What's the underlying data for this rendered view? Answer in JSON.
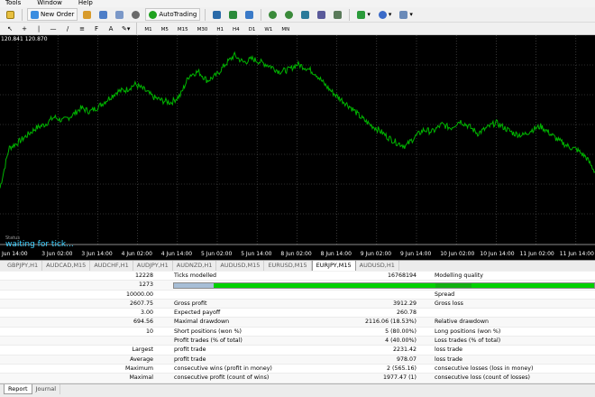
{
  "menu": [
    "Tools",
    "Window",
    "Help"
  ],
  "toolbar": {
    "new_order": "New Order",
    "autotrading": "AutoTrading"
  },
  "timeframes": [
    "M1",
    "M5",
    "M15",
    "M30",
    "H1",
    "H4",
    "D1",
    "W1",
    "MN"
  ],
  "chart": {
    "price_label": "120.841 120.870",
    "status_label": "Status",
    "waiting_text": "waiting for tick...",
    "colors": {
      "background": "#000000",
      "line": "#00b400",
      "grid": "#5a5a5a",
      "axis_text": "#ffffff"
    }
  },
  "chart_data": {
    "type": "line",
    "x_labels": [
      "Jun 14:00",
      "3 Jun 02:00",
      "3 Jun 14:00",
      "4 Jun 02:00",
      "4 Jun 14:00",
      "5 Jun 02:00",
      "5 Jun 14:00",
      "8 Jun 02:00",
      "8 Jun 14:00",
      "9 Jun 02:00",
      "9 Jun 14:00",
      "10 Jun 02:00",
      "10 Jun 14:00",
      "11 Jun 02:00",
      "11 Jun 14:00"
    ],
    "values": [
      62,
      106,
      112,
      120,
      128,
      132,
      140,
      136,
      142,
      150,
      146,
      152,
      160,
      168,
      170,
      176,
      170,
      162,
      158,
      156,
      164,
      186,
      190,
      180,
      186,
      198,
      208,
      200,
      204,
      200,
      196,
      190,
      192,
      198,
      194,
      188,
      176,
      166,
      158,
      150,
      140,
      132,
      126,
      118,
      112,
      108,
      118,
      126,
      124,
      132,
      128,
      136,
      130,
      122,
      128,
      134,
      128,
      122,
      120,
      126,
      130,
      122,
      114,
      108,
      104,
      96,
      80
    ],
    "ylim": [
      0,
      230
    ],
    "grid": true
  },
  "chart_tabs": [
    "GBPJPY,H1",
    "AUDCAD,M15",
    "AUDCHF,H1",
    "AUDJPY,H1",
    "AUDNZD,H1",
    "AUDUSD,M15",
    "EURUSD,M15",
    "EURJPY,M15",
    "AUDUSD,H1"
  ],
  "active_tab": "EURJPY,M15",
  "report": {
    "rows": [
      {
        "v1": "12228",
        "l2": "Ticks modelled",
        "v3": "16768194",
        "l4": "Modelling quality",
        "v5": ""
      },
      {
        "v1": "1273",
        "l2": "",
        "v3": "",
        "l4": "",
        "v5": ""
      },
      {
        "v1": "10000.00",
        "l2": "",
        "v3": "",
        "l4": "Spread",
        "v5": ""
      },
      {
        "v1": "2607.75",
        "l2": "Gross profit",
        "v3": "3912.29",
        "l4": "Gross loss",
        "v5": ""
      },
      {
        "v1": "3.00",
        "l2": "Expected payoff",
        "v3": "260.78",
        "l4": "",
        "v5": ""
      },
      {
        "v1": "694.56",
        "l2": "Maximal drawdown",
        "v3": "2116.06 (18.53%)",
        "l4": "Relative drawdown",
        "v5": ""
      },
      {
        "v1": "10",
        "l2": "Short positions (won %)",
        "v3": "5 (80.00%)",
        "l4": "Long positions (won %)",
        "v5": ""
      },
      {
        "v1": "",
        "l2": "Profit trades (% of total)",
        "v3": "4 (40.00%)",
        "l4": "Loss trades (% of total)",
        "v5": ""
      },
      {
        "v1": "Largest",
        "l2": "profit trade",
        "v3": "2231.42",
        "l4": "loss trade",
        "v5": ""
      },
      {
        "v1": "Average",
        "l2": "profit trade",
        "v3": "978.07",
        "l4": "loss trade",
        "v5": ""
      },
      {
        "v1": "Maximum",
        "l2": "consecutive wins (profit in money)",
        "v3": "2 (565.16)",
        "l4": "consecutive losses (loss in money)",
        "v5": ""
      },
      {
        "v1": "Maximal",
        "l2": "consecutive profit (count of wins)",
        "v3": "1977.47 (1)",
        "l4": "consecutive loss (count of losses)",
        "v5": ""
      }
    ],
    "modelling_quality_colors": {
      "bar": "#00d100",
      "start": "#a7bed6"
    }
  },
  "bottom_tabs": [
    "Report",
    "Journal"
  ]
}
